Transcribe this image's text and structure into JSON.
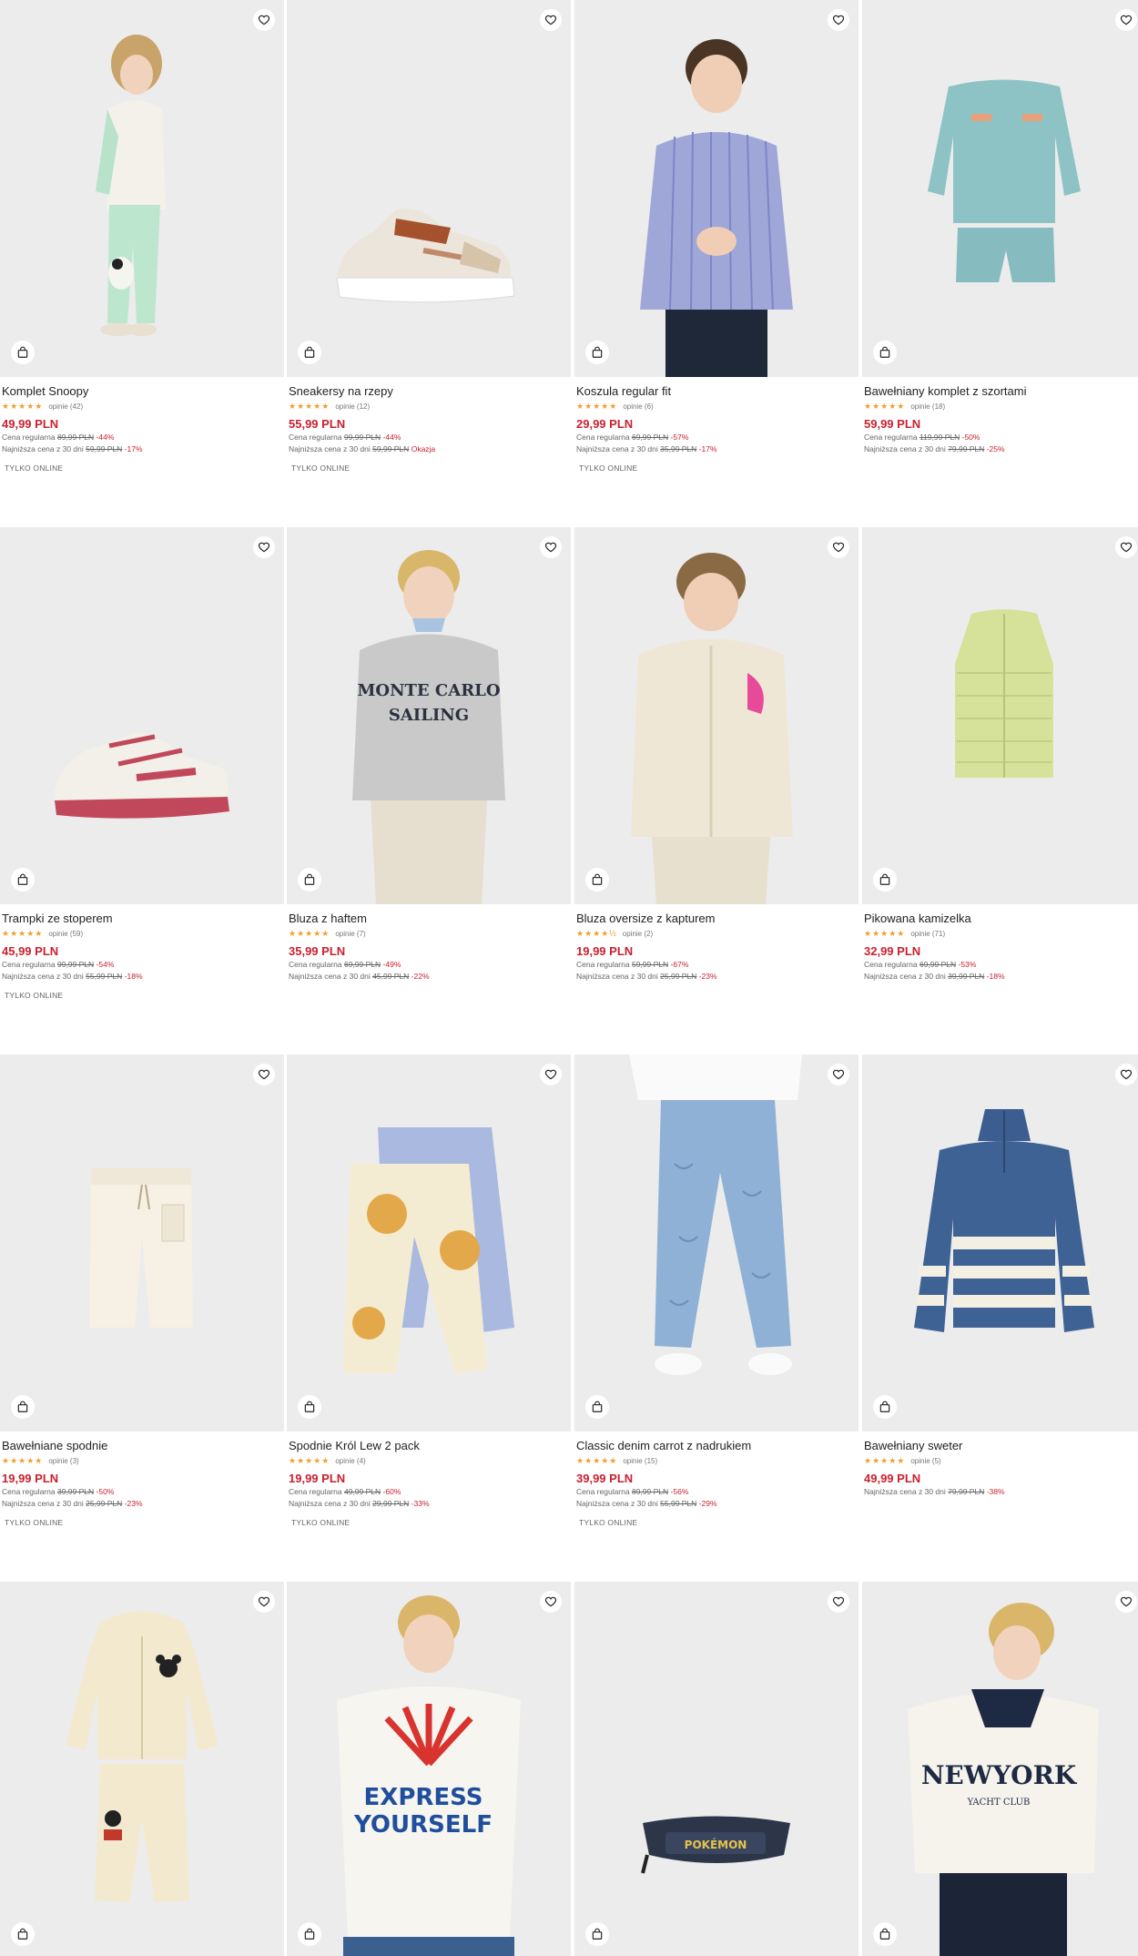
{
  "ui": {
    "favorite_icon": "heart-icon",
    "cart_icon": "shopping-bag-icon",
    "star_icon": "star-icon",
    "regular_price_label": "Cena regularna",
    "lowest_price_label": "Najniższa cena z 30 dni",
    "online_only_badge": "TYLKO ONLINE",
    "accent_color": "#c9212f",
    "star_color": "#f0a030"
  },
  "products": [
    {
      "name": "Komplet Snoopy",
      "stars": "★★★★★",
      "reviews": "opinie (42)",
      "price": "49,99 PLN",
      "regular_old": "89,99 PLN",
      "regular_disc": "-44%",
      "lowest_old": "59,99 PLN",
      "lowest_disc": "-17%",
      "badge": "TYLKO ONLINE"
    },
    {
      "name": "Sneakersy na rzepy",
      "stars": "★★★★★",
      "reviews": "opinie (12)",
      "price": "55,99 PLN",
      "regular_old": "99,99 PLN",
      "regular_disc": "-44%",
      "lowest_old": "59,99 PLN",
      "lowest_disc": "Okazja",
      "badge": "TYLKO ONLINE"
    },
    {
      "name": "Koszula regular fit",
      "stars": "★★★★★",
      "reviews": "opinie (6)",
      "price": "29,99 PLN",
      "regular_old": "69,99 PLN",
      "regular_disc": "-57%",
      "lowest_old": "35,99 PLN",
      "lowest_disc": "-17%",
      "badge": "TYLKO ONLINE"
    },
    {
      "name": "Bawełniany komplet z szortami",
      "stars": "★★★★★",
      "reviews": "opinie (18)",
      "price": "59,99 PLN",
      "regular_old": "119,99 PLN",
      "regular_disc": "-50%",
      "lowest_old": "79,99 PLN",
      "lowest_disc": "-25%",
      "badge": ""
    },
    {
      "name": "Trampki ze stoperem",
      "stars": "★★★★★",
      "reviews": "opinie (59)",
      "price": "45,99 PLN",
      "regular_old": "99,99 PLN",
      "regular_disc": "-54%",
      "lowest_old": "55,99 PLN",
      "lowest_disc": "-18%",
      "badge": "TYLKO ONLINE"
    },
    {
      "name": "Bluza z haftem",
      "stars": "★★★★★",
      "reviews": "opinie (7)",
      "price": "35,99 PLN",
      "regular_old": "69,99 PLN",
      "regular_disc": "-49%",
      "lowest_old": "45,99 PLN",
      "lowest_disc": "-22%",
      "badge": ""
    },
    {
      "name": "Bluza oversize z kapturem",
      "stars": "★★★★½",
      "reviews": "opinie (2)",
      "price": "19,99 PLN",
      "regular_old": "59,99 PLN",
      "regular_disc": "-67%",
      "lowest_old": "25,99 PLN",
      "lowest_disc": "-23%",
      "badge": ""
    },
    {
      "name": "Pikowana kamizelka",
      "stars": "★★★★★",
      "reviews": "opinie (71)",
      "price": "32,99 PLN",
      "regular_old": "69,99 PLN",
      "regular_disc": "-53%",
      "lowest_old": "39,99 PLN",
      "lowest_disc": "-18%",
      "badge": ""
    },
    {
      "name": "Bawełniane spodnie",
      "stars": "★★★★★",
      "reviews": "opinie (3)",
      "price": "19,99 PLN",
      "regular_old": "39,99 PLN",
      "regular_disc": "-50%",
      "lowest_old": "25,99 PLN",
      "lowest_disc": "-23%",
      "badge": "TYLKO ONLINE"
    },
    {
      "name": "Spodnie Król Lew 2 pack",
      "stars": "★★★★★",
      "reviews": "opinie (4)",
      "price": "19,99 PLN",
      "regular_old": "49,99 PLN",
      "regular_disc": "-60%",
      "lowest_old": "29,99 PLN",
      "lowest_disc": "-33%",
      "badge": "TYLKO ONLINE"
    },
    {
      "name": "Classic denim carrot z nadrukiem",
      "stars": "★★★★★",
      "reviews": "opinie (15)",
      "price": "39,99 PLN",
      "regular_old": "89,99 PLN",
      "regular_disc": "-56%",
      "lowest_old": "55,99 PLN",
      "lowest_disc": "-29%",
      "badge": "TYLKO ONLINE"
    },
    {
      "name": "Bawełniany sweter",
      "stars": "★★★★★",
      "reviews": "opinie (5)",
      "price": "49,99 PLN",
      "regular_old": "",
      "regular_disc": "",
      "lowest_old": "79,99 PLN",
      "lowest_disc": "-38%",
      "badge": ""
    },
    {
      "name": "",
      "stars": "",
      "reviews": "",
      "price": "",
      "regular_old": "",
      "regular_disc": "",
      "lowest_old": "",
      "lowest_disc": "",
      "badge": ""
    },
    {
      "name": "",
      "stars": "",
      "reviews": "",
      "price": "",
      "regular_old": "",
      "regular_disc": "",
      "lowest_old": "",
      "lowest_disc": "",
      "badge": ""
    },
    {
      "name": "",
      "stars": "",
      "reviews": "",
      "price": "",
      "regular_old": "",
      "regular_disc": "",
      "lowest_old": "",
      "lowest_disc": "",
      "badge": ""
    },
    {
      "name": "",
      "stars": "",
      "reviews": "",
      "price": "",
      "regular_old": "",
      "regular_disc": "",
      "lowest_old": "",
      "lowest_disc": "",
      "badge": ""
    }
  ],
  "image_text": {
    "sweatshirt_print_1": "MONTE CARLO",
    "sweatshirt_print_2": "SAILING",
    "tshirt_print_1": "EXPRESS",
    "tshirt_print_2": "YOURSELF",
    "polo_print_1": "NEWYORK",
    "polo_print_2": "YACHT CLUB",
    "bag_print": "POKÉMON"
  }
}
